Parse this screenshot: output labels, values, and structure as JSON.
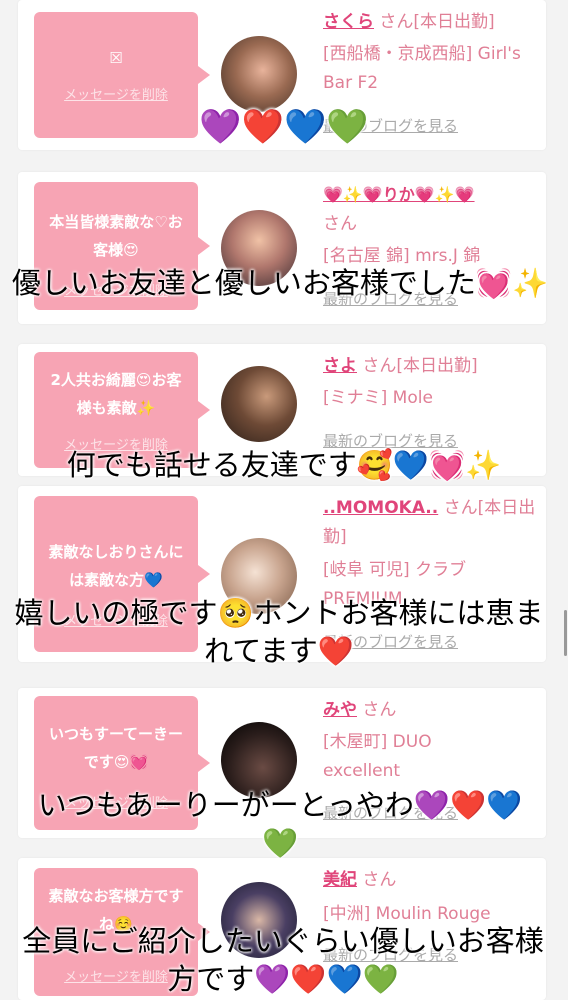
{
  "cards": [
    {
      "message": "☒",
      "delete": "メッセージを削除",
      "name": "さくら",
      "suffix": "さん[本日出勤]",
      "shop": "[西船橋・京成西船] Girl's Bar F2",
      "blog": "最新のブログを見る"
    },
    {
      "message": "本当皆様素敵な♡お客様😍",
      "delete": "メッセージを削除",
      "name": "💗✨💗りか💗✨💗",
      "suffix": "さん",
      "shop": "[名古屋 錦] mrs.J 錦",
      "blog": "最新のブログを見る"
    },
    {
      "message": "2人共お綺麗😍お客様も素敵✨",
      "delete": "メッセージを削除",
      "name": "さよ",
      "suffix": "さん[本日出勤]",
      "shop": "[ミナミ] Mole",
      "blog": "最新のブログを見る"
    },
    {
      "message": "素敵なしおりさんには素敵な方💙",
      "delete": "メッセージを削除",
      "name": "..MOMOKA..",
      "suffix": "さん[本日出勤]",
      "shop": "[岐阜 可児] クラブPREMIUM",
      "blog": "最新のブログを見る"
    },
    {
      "message": "いつもすーてーきーです😍💓",
      "delete": "メッセージを削除",
      "name": "みや",
      "suffix": "さん",
      "shop": "[木屋町] DUO excellent",
      "blog": "最新のブログを見る"
    },
    {
      "message": "素敵なお客様方ですね☺️",
      "delete": "メッセージを削除",
      "name": "美紀",
      "suffix": "さん",
      "shop": "[中洲] Moulin Rouge",
      "blog": "最新のブログを見る"
    }
  ],
  "overlays": [
    "💜❤️💙💚",
    "優しいお友達と優しいお客様でした💓✨",
    "何でも話せる友達です🥰💙💓✨",
    "嬉しいの極です🥺ホントお客様には恵まれてます❤️",
    "いつもあーりーがーとっやわ💜❤️💙💚",
    "全員にご紹介したいぐらい優しいお客様方です💜❤️💙💚"
  ]
}
